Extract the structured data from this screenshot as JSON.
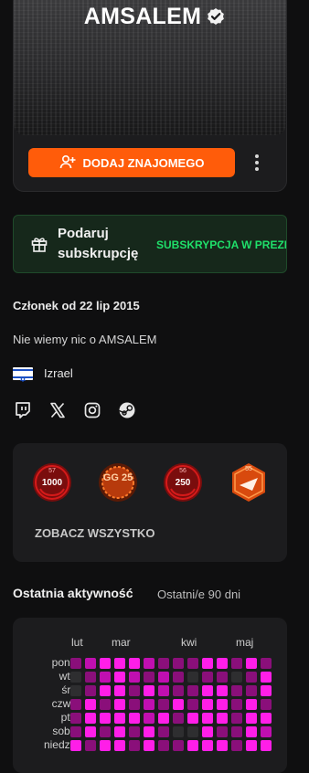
{
  "profile": {
    "name": "AMSALEM",
    "add_friend_label": "DODAJ ZNAJOMEGO"
  },
  "gift": {
    "text": "Podaruj subskrupcję",
    "cta": "SUBSKRYPCJA W PREZENCIE"
  },
  "member_since": "Członek od 22 lip 2015",
  "about": "Nie wiemy nic o AMSALEM",
  "country": "Izrael",
  "socials": [
    "twitch-icon",
    "x-icon",
    "instagram-icon",
    "steam-icon"
  ],
  "badges": [
    {
      "top": "57",
      "value": "1000"
    },
    {
      "top": "",
      "value": "GG 25"
    },
    {
      "top": "56",
      "value": "250"
    },
    {
      "top": "55",
      "value": ""
    }
  ],
  "see_all": "ZOBACZ WSZYSTKO",
  "activity": {
    "title": "Ostatnia aktywność",
    "subtitle": "Ostatni/e 90 dni",
    "months": [
      "lut",
      "mar",
      "kwi",
      "maj"
    ],
    "days": [
      "pon.",
      "wt.",
      "śr.",
      "czw.",
      "pt.",
      "sob.",
      "niedz."
    ],
    "levels": [
      [
        1,
        2,
        3,
        3,
        3,
        2,
        1,
        1,
        1,
        3,
        3,
        1,
        3,
        1
      ],
      [
        0,
        1,
        2,
        3,
        2,
        1,
        2,
        1,
        0,
        1,
        1,
        0,
        1,
        3
      ],
      [
        0,
        1,
        3,
        3,
        1,
        3,
        2,
        1,
        1,
        3,
        3,
        1,
        1,
        3
      ],
      [
        1,
        3,
        1,
        3,
        1,
        2,
        1,
        3,
        1,
        3,
        3,
        1,
        3,
        1
      ],
      [
        1,
        3,
        3,
        3,
        3,
        2,
        3,
        1,
        3,
        3,
        3,
        1,
        3,
        3
      ],
      [
        1,
        3,
        1,
        3,
        1,
        3,
        1,
        0,
        0,
        3,
        1,
        1,
        3,
        2
      ],
      [
        3,
        1,
        3,
        3,
        1,
        3,
        1,
        1,
        3,
        3,
        3,
        1,
        3,
        3
      ]
    ],
    "colors": [
      "#2e2e30",
      "#8a0f7a",
      "#c00fb0",
      "#ff1ee8"
    ]
  },
  "colors": {
    "accent": "#ff5c0a",
    "gift_green": "#1fe06a",
    "badge_red": "#d51a1a"
  }
}
